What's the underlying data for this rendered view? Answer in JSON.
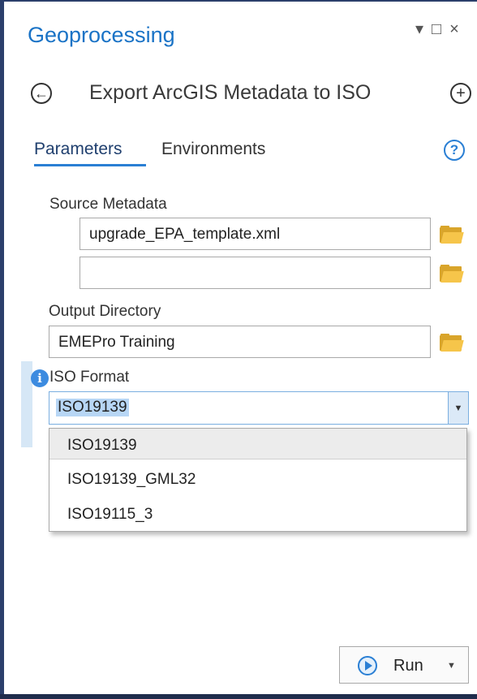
{
  "pane": {
    "title": "Geoprocessing",
    "controls": {
      "menu": "▾",
      "maximize": "□",
      "close": "×"
    }
  },
  "tool": {
    "title": "Export ArcGIS Metadata to ISO",
    "back_icon": "back-arrow-icon",
    "add_icon": "add-icon"
  },
  "tabs": {
    "parameters": "Parameters",
    "environments": "Environments",
    "help_symbol": "?"
  },
  "params": {
    "source_metadata": {
      "label": "Source Metadata",
      "values": [
        "upgrade_EPA_template.xml",
        ""
      ]
    },
    "output_directory": {
      "label": "Output Directory",
      "value": "EMEPro Training"
    },
    "iso_format": {
      "label": "ISO Format",
      "selected": "ISO19139",
      "options": [
        "ISO19139",
        "ISO19139_GML32",
        "ISO19115_3"
      ]
    }
  },
  "run": {
    "label": "Run"
  }
}
